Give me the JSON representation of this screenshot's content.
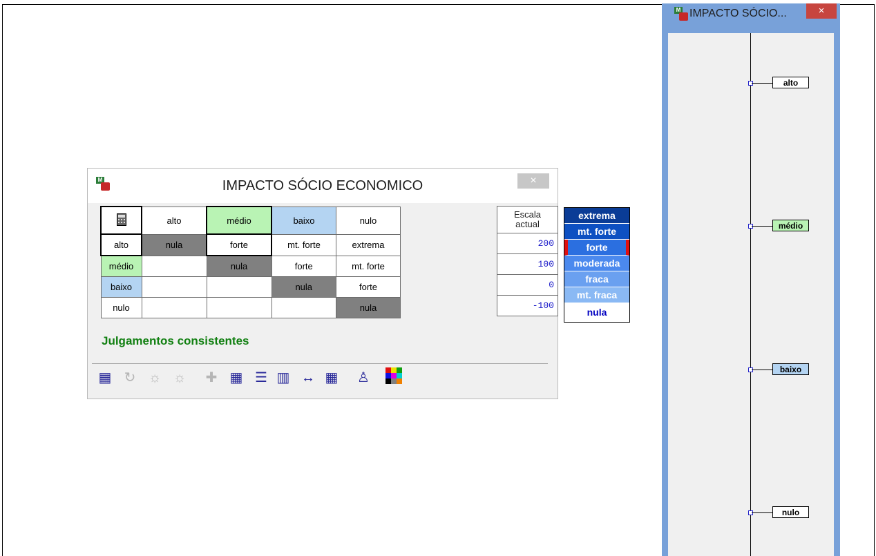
{
  "dialog": {
    "title": "IMPACTO SÓCIO ECONOMICO",
    "close_label": "×",
    "matrix": {
      "corner_icon": "calculator-icon",
      "columns": [
        "alto",
        "médio",
        "baixo",
        "nulo"
      ],
      "rows": [
        {
          "label": "alto",
          "cells": [
            "nula",
            "forte",
            "mt. forte",
            "extrema"
          ]
        },
        {
          "label": "médio",
          "cells": [
            "",
            "nula",
            "forte",
            "mt. forte"
          ]
        },
        {
          "label": "baixo",
          "cells": [
            "",
            "",
            "nula",
            "forte"
          ]
        },
        {
          "label": "nulo",
          "cells": [
            "",
            "",
            "",
            "nula"
          ]
        }
      ]
    },
    "escala": {
      "header_line1": "Escala",
      "header_line2": "actual",
      "values": [
        "200",
        "100",
        "0",
        "-100"
      ]
    },
    "scale": {
      "items": [
        {
          "label": "extrema",
          "color": "#0a3c96"
        },
        {
          "label": "mt. forte",
          "color": "#0d50c2"
        },
        {
          "label": "forte",
          "color": "#2b6fe0",
          "selected": true
        },
        {
          "label": "moderada",
          "color": "#4b89ee"
        },
        {
          "label": "fraca",
          "color": "#6aa0f0"
        },
        {
          "label": "mt. fraca",
          "color": "#8ab9f4"
        },
        {
          "label": "nula",
          "color": "#ffffff",
          "text_color": "#0000c0"
        }
      ]
    },
    "status": "Julgamentos consistentes",
    "toolbar": [
      {
        "icon": "ok-check-grid-icon",
        "glyph": "▦"
      },
      {
        "icon": "refresh-icon",
        "glyph": "↻"
      },
      {
        "icon": "lightbulb-icon",
        "glyph": "☼"
      },
      {
        "icon": "lightbulb-ok-icon",
        "glyph": "☼"
      },
      {
        "icon": "add-group-icon",
        "glyph": "✚"
      },
      {
        "icon": "grid-export-icon",
        "glyph": "▦"
      },
      {
        "icon": "list-scale-icon",
        "glyph": "☰"
      },
      {
        "icon": "macbeth-icon",
        "glyph": "▥"
      },
      {
        "icon": "interval-icon",
        "glyph": "↔"
      },
      {
        "icon": "diff-icon",
        "glyph": "▦"
      },
      {
        "icon": "person-scale-icon",
        "glyph": "♙"
      },
      {
        "icon": "color-palette-icon",
        "glyph": "■"
      }
    ]
  },
  "right_panel": {
    "title": "IMPACTO SÓCIO...",
    "close_label": "×",
    "levels": [
      {
        "label": "alto",
        "color": "#ffffff"
      },
      {
        "label": "médio",
        "color": "#b9f3b4"
      },
      {
        "label": "baixo",
        "color": "#b4d4f2"
      },
      {
        "label": "nulo",
        "color": "#ffffff"
      }
    ]
  }
}
